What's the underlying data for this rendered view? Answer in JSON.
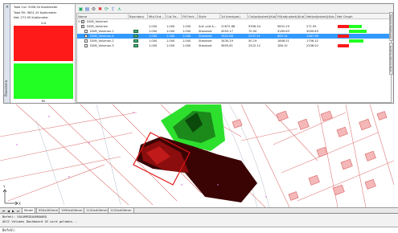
{
  "palette": {
    "title": "Panorama",
    "close_glyph": "×",
    "summary": {
      "total_cut": "Total Cut: 9356.34 Kubikmeter",
      "total_fill": "Total Fill: 9831.29 Kubikmeter",
      "net": "Net: 271.95 Kubikmeter",
      "cut_label": "Cut",
      "fill_label": "Fill"
    },
    "colors": {
      "cut": "#ff1a1a",
      "fill": "#22ff22",
      "selection": "#3399ff"
    },
    "toolbar_icons": [
      "new-volume-icon",
      "dashboard-icon",
      "options-icon",
      "delete-icon",
      "refresh-icon",
      "export-icon",
      "chart-icon"
    ],
    "columns": [
      "Name",
      "Boundary",
      "Mid-Ord...",
      "Cut Fa...",
      "Fill Fact...",
      "Style",
      "2d Area(qm)",
      "Cut(adjusted)(Kub...",
      "Fill(adjusted)(Kub...",
      "Net(adjusted)(Kub...",
      "Net Graph"
    ],
    "rows": [
      {
        "name": "DGM_Volumen",
        "mid": "",
        "cut_f": "",
        "fill_f": "",
        "style": "",
        "area": "",
        "cut": "",
        "fill": "",
        "net": "",
        "selected": false,
        "header": true
      },
      {
        "name": "DGM_Volumen",
        "mid": "1.000",
        "cut_f": "1.000",
        "fill_f": "1.000",
        "style": "Auf- und A...",
        "area": "21672.86",
        "cut": "9356.34",
        "fill": "9631.29",
        "net": "271.95",
        "selected": false
      },
      {
        "name": "DGM_Voluman.1",
        "mid": "1.000",
        "cut_f": "1.000",
        "fill_f": "1.000",
        "style": "Standard",
        "area": "4555.17",
        "cut": "70.00",
        "fill": "3169.63",
        "net": "3099.63",
        "selected": false
      },
      {
        "name": "DGM_Voluman.4",
        "mid": "1.000",
        "cut_f": "1.000",
        "fill_f": "1.000",
        "style": "Standard",
        "area": "7822.66",
        "cut": "2257.91",
        "fill": "869.14",
        "net": "1387.96",
        "selected": true
      },
      {
        "name": "DGM_Voluman.2",
        "mid": "1.000",
        "cut_f": "1.000",
        "fill_f": "1.000",
        "style": "Standard",
        "area": "3430.29",
        "cut": "50.19",
        "fill": "1806.51",
        "net": "1756.32",
        "selected": false
      },
      {
        "name": "DGM_Voluman.3",
        "mid": "1.000",
        "cut_f": "1.000",
        "fill_f": "1.000",
        "style": "Standard",
        "area": "5655.81",
        "cut": "2522.12",
        "fill": "186.10",
        "net": "2336.02",
        "selected": false
      }
    ]
  },
  "side_tabs": [
    "Volumes Dashboard",
    "Grading Volume Tools"
  ],
  "layout_tabs": [
    "Model",
    "950x400mm",
    "1950x400mm",
    "1120x400mm",
    "1120x400mm"
  ],
  "command": {
    "history": [
      "Befehl: VOLUMESDASHBOARD",
      "AECC Volumes Dashboard UI wird geladen..."
    ],
    "prompt": "Befehl:"
  }
}
